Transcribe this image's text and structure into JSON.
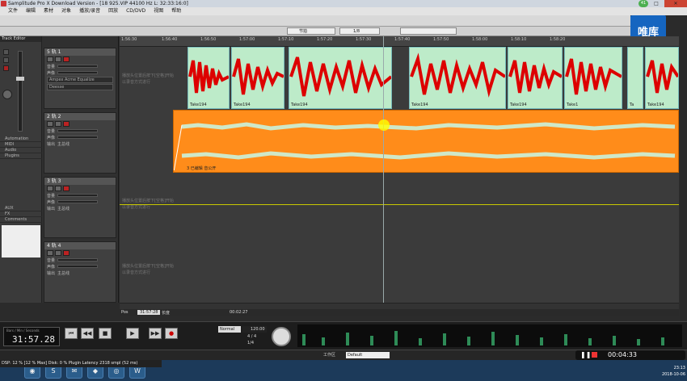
{
  "window": {
    "title": "Samplitude Pro X Download Version - [18 925.VIP   44100 Hz L: 32:33:16:0]",
    "minimize": "─",
    "maximize": "□",
    "close": "✕"
  },
  "menu": [
    "文件",
    "编辑",
    "素材",
    "对象",
    "播放/录音",
    "回放",
    "CD/DVD",
    "视图",
    "帮助"
  ],
  "toolbar": {
    "snap_label": "节拍",
    "grid_value": "1/8"
  },
  "logo": "唯库",
  "badge": "41",
  "ruler": {
    "ticks": [
      "1:56:30",
      "1:56:40",
      "1:56:50",
      "1:57:00",
      "1:57:10",
      "1:57:20",
      "1:57:30",
      "1:57:40",
      "1:57:50",
      "1:58:00",
      "1:58:10",
      "1:58:20"
    ]
  },
  "tracks": [
    {
      "num": "5",
      "name": "轨 1",
      "fx1": "Ampex Acme Equalize",
      "fx2": "Deesse"
    },
    {
      "num": "2",
      "name": "轨 2",
      "fx1": "",
      "fx2": ""
    },
    {
      "num": "3",
      "name": "轨 3",
      "fx1": "",
      "fx2": ""
    },
    {
      "num": "4",
      "name": "轨 4",
      "fx1": "",
      "fx2": ""
    }
  ],
  "track_rows": {
    "vol": "音量",
    "pan": "声像",
    "out": "输出",
    "route": "主总线"
  },
  "sidebar": {
    "title": "Track Editor",
    "items": [
      "Automation",
      "MIDI",
      "Audio",
      "Plugins",
      "AUX",
      "FX",
      "Comments"
    ]
  },
  "clips": {
    "take_label": "Take194",
    "take_labels": [
      "Take194",
      "Take194",
      "Take194",
      "Take194",
      "Take194",
      "Take1",
      "Ta",
      "Take194"
    ],
    "orange_label": "3 已编辑 音公开"
  },
  "ghost_text": "播放头位置后按下[空格]开始\n以录音方式进行",
  "transport": {
    "time_caption": "Bars / Min / Seconds",
    "time": "31:57.28",
    "sync": "Normal",
    "tempo": "120.00",
    "sig": "4 / 4",
    "marker": "1/4"
  },
  "position": {
    "pos_label": "Pos",
    "pos_value": "31:57:28",
    "len_label": "长度",
    "end_value": "00:02:27"
  },
  "status": {
    "dsp": "DSP: 12 % [12 % Max]   Disk: 0 %  Plugin Latency 2318 smpl (52 ms)",
    "workspace_label": "工作区",
    "workspace_value": "Default"
  },
  "recorder": {
    "time": "00:04:33"
  },
  "clock": {
    "time": "23:13",
    "date": "2018-10-06"
  }
}
